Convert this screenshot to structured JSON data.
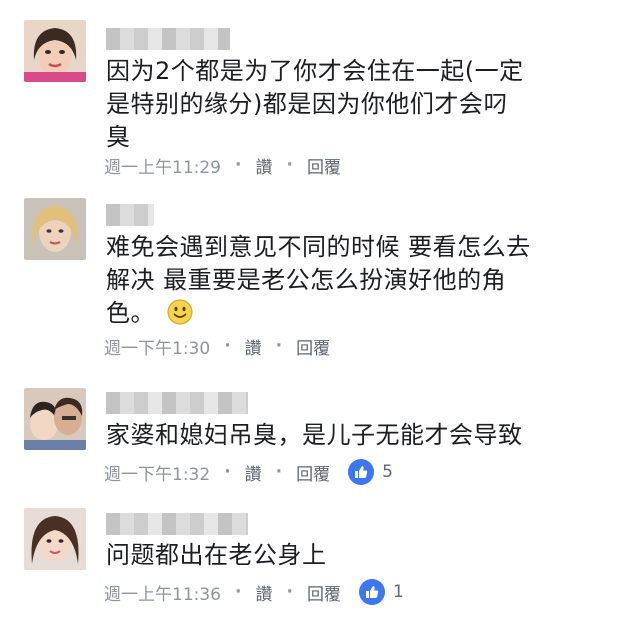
{
  "comments": [
    {
      "text_lines": [
        "因为2个都是为了你才会住在一起(一定",
        "是特别的缘分)都是因为你他们才会叼",
        "臭"
      ],
      "time": "週一上午11:29",
      "like_label": "讚",
      "reply_label": "回覆",
      "reaction_count": ""
    },
    {
      "text_lines": [
        "难免会遇到意见不同的时候 要看怎么去",
        "解决 最重要是老公怎么扮演好他的角",
        "色。"
      ],
      "time": "週一下午1:30",
      "like_label": "讚",
      "reply_label": "回覆",
      "reaction_count": ""
    },
    {
      "text_lines": [
        "家婆和媳妇吊臭，是儿子无能才会导致"
      ],
      "time": "週一下午1:32",
      "like_label": "讚",
      "reply_label": "回覆",
      "reaction_count": "5"
    },
    {
      "text_lines": [
        "问题都出在老公身上"
      ],
      "time": "週一上午11:36",
      "like_label": "讚",
      "reply_label": "回覆",
      "reaction_count": "1"
    }
  ],
  "colors": {
    "text": "#1c1e21",
    "meta": "#90949c",
    "like_badge": "#3b77f0"
  },
  "icons": {
    "reaction": "thumbs-up-icon",
    "emoji": "smiley-icon"
  }
}
